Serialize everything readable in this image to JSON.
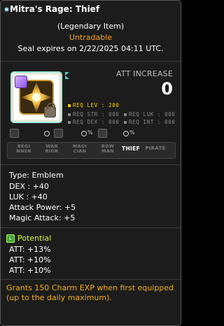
{
  "header": {
    "title": "Mitra's Rage: Thief",
    "rarity": "(Legendary Item)",
    "tradability": "Untradable",
    "seal_expiry": "Seal expires on 2/22/2025 04:11 UTC."
  },
  "stats_top": {
    "att_increase_label": "ATT INCREASE",
    "att_increase_value": "0"
  },
  "requirements": {
    "lev": "REQ LEV : 200",
    "str": "REQ STR : 000",
    "luk": "REQ LUK : 000",
    "dex": "REQ DEX : 000",
    "int": "REQ INT : 000"
  },
  "icon_row": {
    "values": [
      "0",
      "0",
      "0 %",
      "0 %"
    ]
  },
  "jobs": [
    {
      "label": "BEGI\nNNER"
    },
    {
      "label": "WAR\nRIOR"
    },
    {
      "label": "MAGI\nCIAN"
    },
    {
      "label": "BOW\nMAN"
    },
    {
      "label": "THIEF"
    },
    {
      "label": "PIRATE"
    }
  ],
  "details": {
    "type": "Type: Emblem",
    "dex": "DEX : +40",
    "luk": "LUK : +40",
    "attack_power": "Attack Power: +5",
    "magic_attack": "Magic Attack: +5"
  },
  "potential": {
    "header": "Potential",
    "icon_letter": "L",
    "lines": [
      "ATT: +13%",
      "ATT: +10%",
      "ATT: +10%"
    ]
  },
  "charm": {
    "line1": "Grants 150 Charm EXP when first equipped",
    "line2": "(up to the daily maximum)."
  },
  "colors": {
    "background": "#1c1c1c",
    "tradability": "#f5a623",
    "potential": "#d8ff32",
    "charm": "#f5b015",
    "req_lev_text": "#f5d300",
    "req_inactive_text": "#888888",
    "border_accent": "#9ae8d6"
  }
}
